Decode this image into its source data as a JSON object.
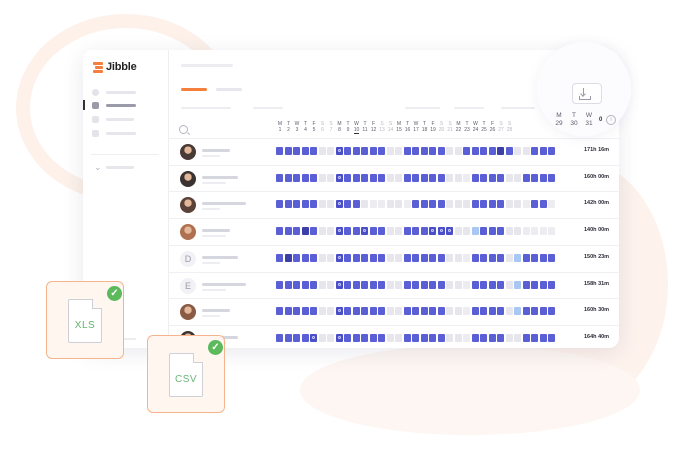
{
  "app": {
    "name": "Jibble"
  },
  "colors": {
    "accent": "#f5803e",
    "worked": "#5b5fd6",
    "overtime": "#3d3fa8",
    "leave": "#a9c7f4",
    "off": "#e6e6ec",
    "export_check": "#5cba5d"
  },
  "timesheet": {
    "days": [
      {
        "d": "M",
        "n": "1"
      },
      {
        "d": "T",
        "n": "2"
      },
      {
        "d": "W",
        "n": "3"
      },
      {
        "d": "T",
        "n": "4"
      },
      {
        "d": "F",
        "n": "5"
      },
      {
        "d": "S",
        "n": "6",
        "we": true
      },
      {
        "d": "S",
        "n": "7",
        "we": true
      },
      {
        "d": "M",
        "n": "8"
      },
      {
        "d": "T",
        "n": "9"
      },
      {
        "d": "W",
        "n": "10",
        "today": true
      },
      {
        "d": "T",
        "n": "11"
      },
      {
        "d": "F",
        "n": "12"
      },
      {
        "d": "S",
        "n": "13",
        "we": true
      },
      {
        "d": "S",
        "n": "14",
        "we": true
      },
      {
        "d": "M",
        "n": "15"
      },
      {
        "d": "T",
        "n": "16"
      },
      {
        "d": "W",
        "n": "17"
      },
      {
        "d": "T",
        "n": "18"
      },
      {
        "d": "F",
        "n": "19"
      },
      {
        "d": "S",
        "n": "20",
        "we": true
      },
      {
        "d": "S",
        "n": "21",
        "we": true
      },
      {
        "d": "M",
        "n": "22"
      },
      {
        "d": "T",
        "n": "23"
      },
      {
        "d": "W",
        "n": "24"
      },
      {
        "d": "T",
        "n": "25"
      },
      {
        "d": "F",
        "n": "26"
      },
      {
        "d": "S",
        "n": "27",
        "we": true
      },
      {
        "d": "S",
        "n": "28",
        "we": true
      }
    ],
    "tail_days": [
      {
        "d": "M",
        "n": "29"
      },
      {
        "d": "T",
        "n": "30"
      },
      {
        "d": "W",
        "n": "31"
      }
    ],
    "tail_count": "0",
    "rows": [
      {
        "avatar": "photo",
        "initial": "",
        "total": "171h 16m",
        "cells": "bbbbbooibbbbboobbbbboobbbbdboobbb"
      },
      {
        "avatar": "photo",
        "initial": "",
        "total": "160h 00m",
        "cells": "bbbbbooibbbbboobbbbbooebbbboobbbb"
      },
      {
        "avatar": "photo",
        "initial": "",
        "total": "142h 00m",
        "cells": "bbbbbooibboeeooebbbbooobbbbooebbe"
      },
      {
        "avatar": "photo",
        "initial": "",
        "total": "140h 00m",
        "cells": "bbbdbooibbibboobbbiiioolbbbooeeee"
      },
      {
        "avatar": "letter",
        "initial": "D",
        "total": "150h 23m",
        "cells": "bdbbbooibbbbboobbbbbooebbbbolbbbb"
      },
      {
        "avatar": "letter",
        "initial": "E",
        "total": "158h 31m",
        "cells": "bbbbbooibbbbboobbbbbooebbbbolbbbb"
      },
      {
        "avatar": "photo",
        "initial": "",
        "total": "160h 30m",
        "cells": "bbbbbooibbbbboobbbbbooebbbbolbbbb"
      },
      {
        "avatar": "photo",
        "initial": "",
        "total": "164h 40m",
        "cells": "bbbbiooibbbbboobbbbbooebbbboobbbb"
      }
    ]
  },
  "exports": [
    {
      "label": "XLS"
    },
    {
      "label": "CSV"
    }
  ]
}
